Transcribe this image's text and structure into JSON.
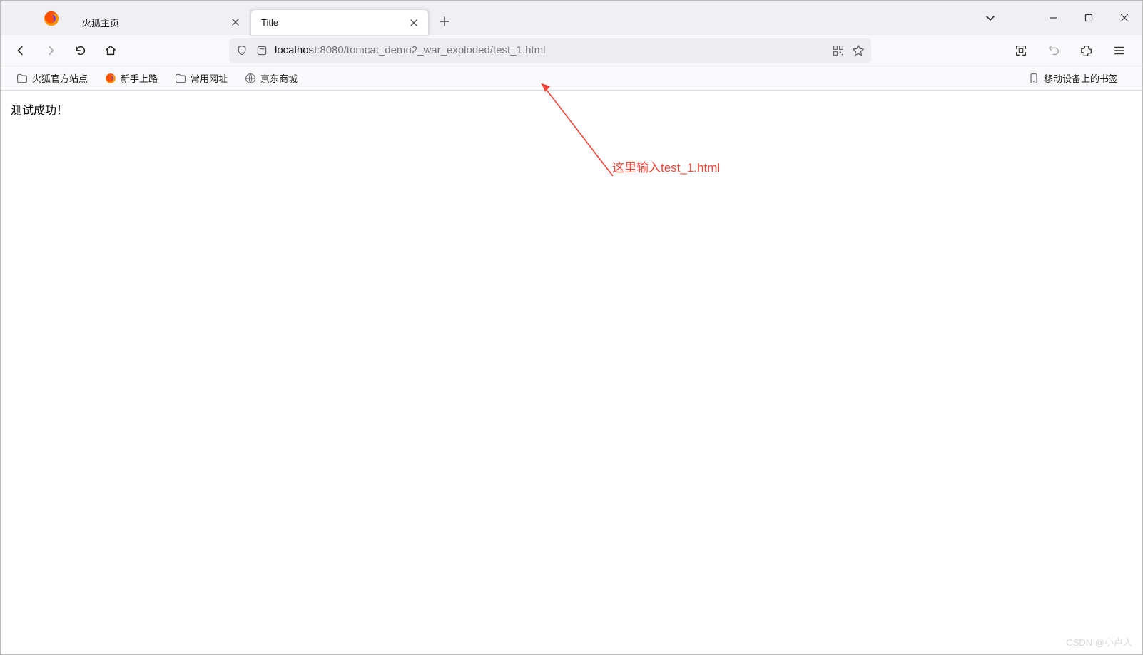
{
  "tabs": [
    {
      "label": "火狐主页"
    },
    {
      "label": "Title"
    }
  ],
  "url": {
    "host": "localhost",
    "rest": ":8080/tomcat_demo2_war_exploded/test_1.html"
  },
  "bookmarks": [
    {
      "label": "火狐官方站点",
      "icon": "folder"
    },
    {
      "label": "新手上路",
      "icon": "firefox"
    },
    {
      "label": "常用网址",
      "icon": "folder"
    },
    {
      "label": "京东商城",
      "icon": "globe"
    }
  ],
  "mobile_bookmark": "移动设备上的书签",
  "page": {
    "body_text": "测试成功！"
  },
  "annotation": {
    "text": "这里输入test_1.html"
  },
  "watermark": "CSDN @小卢人"
}
